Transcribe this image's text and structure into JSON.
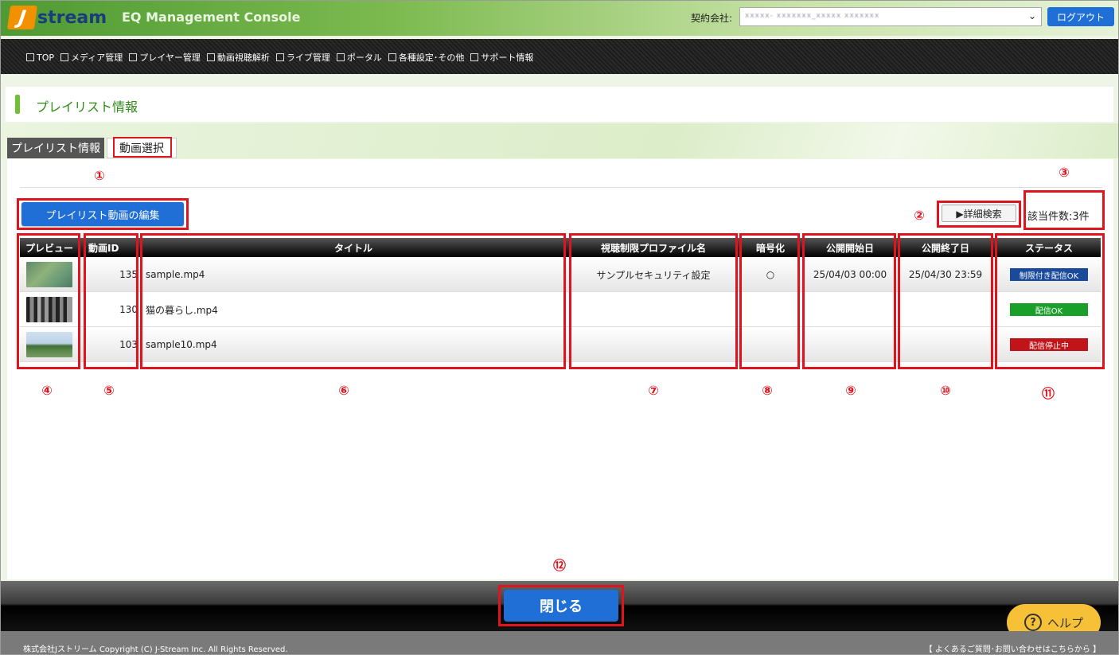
{
  "header": {
    "logo_j": "J",
    "logo_text": "stream",
    "console_title": "EQ Management Console",
    "contract_label": "契約会社:",
    "contract_value": "xxxxx- xxxxxxx_xxxxx xxxxxxx",
    "logout_label": "ログアウト"
  },
  "nav": {
    "items": [
      "TOP",
      "メディア管理",
      "プレイヤー管理",
      "動画視聴解析",
      "ライブ管理",
      "ポータル",
      "各種設定･その他",
      "サポート情報"
    ]
  },
  "page": {
    "title": "プレイリスト情報"
  },
  "tabs": {
    "active": "プレイリスト情報",
    "other": "動画選択"
  },
  "toolbar": {
    "edit_label": "プレイリスト動画の編集",
    "search_label": "▶詳細検索",
    "count_text": "該当件数:3件"
  },
  "annotations": [
    "①",
    "②",
    "③",
    "④",
    "⑤",
    "⑥",
    "⑦",
    "⑧",
    "⑨",
    "⑩",
    "⑪",
    "⑫"
  ],
  "table": {
    "headers": [
      "プレビュー",
      "動画ID",
      "タイトル",
      "視聴制限プロファイル名",
      "暗号化",
      "公開開始日",
      "公開終了日",
      "ステータス"
    ],
    "rows": [
      {
        "id": "135",
        "title": "sample.mp4",
        "profile": "サンプルセキュリティ設定",
        "encrypt": "○",
        "start": "25/04/03 00:00",
        "end": "25/04/30 23:59",
        "status": "制限付き配信OK",
        "status_color": "#1a4a9c"
      },
      {
        "id": "130",
        "title": "猫の暮らし.mp4",
        "profile": "",
        "encrypt": "",
        "start": "",
        "end": "",
        "status": "配信OK",
        "status_color": "#1aa02a"
      },
      {
        "id": "103",
        "title": "sample10.mp4",
        "profile": "",
        "encrypt": "",
        "start": "",
        "end": "",
        "status": "配信停止中",
        "status_color": "#c0141a"
      }
    ]
  },
  "bottom": {
    "close_label": "閉じる",
    "help_label": "ヘルプ",
    "help_icon": "?"
  },
  "footer": {
    "left": "株式会社Jストリーム  Copyright (C) J-Stream Inc. All Rights Reserved.",
    "right": "【 よくあるご質問･お問い合わせはこちらから 】"
  }
}
